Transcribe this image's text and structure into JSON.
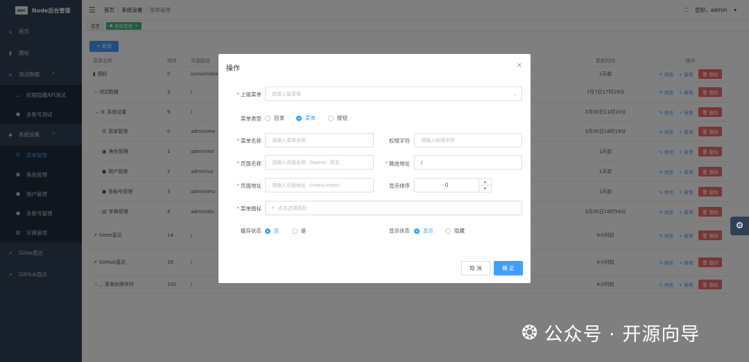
{
  "sidebar": {
    "logo_badge": "NBPF",
    "app_name": "Node后台管理",
    "items": [
      {
        "label": "首页"
      },
      {
        "label": "图标"
      },
      {
        "label": "测试数据"
      },
      {
        "label": "权限隐藏API测试"
      },
      {
        "label": "多账号测试"
      },
      {
        "label": "系统设置"
      },
      {
        "label": "菜单管理"
      },
      {
        "label": "角色管理"
      },
      {
        "label": "用户管理"
      },
      {
        "label": "多账号管理"
      },
      {
        "label": "字典管理"
      },
      {
        "label": "Gitee直达"
      },
      {
        "label": "GitHub直达"
      }
    ]
  },
  "header": {
    "breadcrumb": [
      "首页",
      "系统设置",
      "菜单管理"
    ],
    "user": "您好，admin"
  },
  "tags": [
    "首页",
    "菜单管理"
  ],
  "toolbar": {
    "add_label": "+ 新增"
  },
  "table": {
    "columns": [
      "菜单名称",
      "排序",
      "页面路径",
      "更新时间",
      "操作"
    ],
    "ops": {
      "edit": "修改",
      "add": "新增",
      "delete": "删除"
    },
    "rows": [
      {
        "name": "图标",
        "sort": "0",
        "path": "icons/index",
        "time": "1天前"
      },
      {
        "name": "测试数据",
        "sort": "3",
        "path": "/",
        "time": "7月7日17时19分"
      },
      {
        "name": "系统设置",
        "sort": "9",
        "path": "/",
        "time": "3月30日11时10分"
      },
      {
        "name": "菜单管理",
        "sort": "0",
        "path": "admin/me",
        "time": "3月30日16时18分"
      },
      {
        "name": "角色管理",
        "sort": "1",
        "path": "admin/rol",
        "time": "1天前"
      },
      {
        "name": "用户管理",
        "sort": "2",
        "path": "admin/us",
        "time": "1天前"
      },
      {
        "name": "多账号管理",
        "sort": "3",
        "path": "admin/mu",
        "time": "1天前"
      },
      {
        "name": "字典管理",
        "sort": "4",
        "path": "admin/dic",
        "time": "3月30日16时58分"
      },
      {
        "name": "Gitee直达",
        "sort": "14",
        "path": "/",
        "time": "4小时前"
      },
      {
        "name": "GitHub直达",
        "sort": "16",
        "path": "/",
        "time": "4小时前"
      },
      {
        "name": "菜单权限字符",
        "sort": "100",
        "path": "/",
        "time": "4小时前"
      }
    ],
    "hidden_tag": "隐藏",
    "button_tag": "按钮"
  },
  "dialog": {
    "title": "操作",
    "parent_label": "上级菜单",
    "parent_placeholder": "选择上级菜单",
    "type_label": "菜单类型",
    "type_options": [
      "目录",
      "菜单",
      "按钮"
    ],
    "name_label": "菜单名称",
    "name_placeholder": "请输入菜单名称",
    "perm_label": "权限字符",
    "perm_placeholder": "请输入权限字符",
    "pagename_label": "页面名称",
    "pagename_placeholder": "请输入页面名称（Name）英文",
    "route_label": "路由地址",
    "route_value": "/",
    "pageaddr_label": "页面地址",
    "pageaddr_placeholder": "请输入页面地址（index/index）",
    "order_label": "显示排序",
    "order_value": "0",
    "icon_label": "菜单图标",
    "icon_placeholder": "点击选择图标",
    "cache_label": "缓存状态",
    "cache_options": [
      "否",
      "是"
    ],
    "visible_label": "显示状态",
    "visible_options": [
      "显示",
      "隐藏"
    ],
    "cancel_label": "取 消",
    "ok_label": "确 定"
  },
  "watermark": {
    "text": "公众号 · 开源向导"
  }
}
